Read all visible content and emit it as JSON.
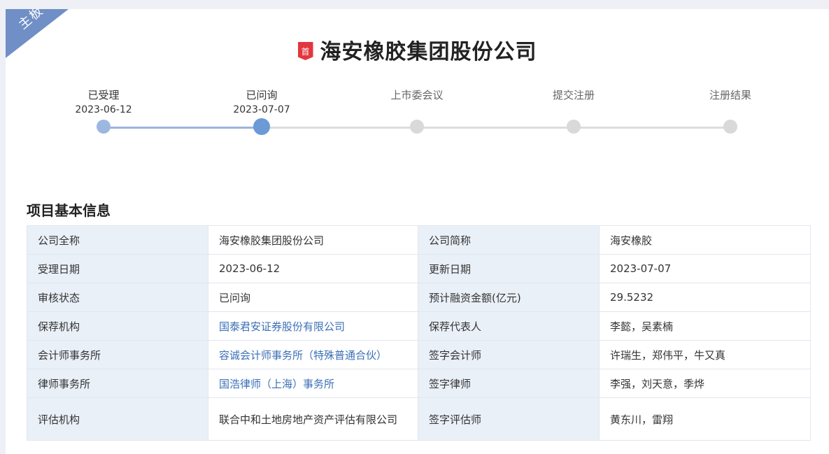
{
  "ribbon": {
    "label": "主板"
  },
  "header": {
    "badge": "首",
    "title": "海安橡胶集团股份公司"
  },
  "timeline": {
    "steps": [
      {
        "label": "已受理",
        "date": "2023-06-12",
        "state": "done"
      },
      {
        "label": "已问询",
        "date": "2023-07-07",
        "state": "current"
      },
      {
        "label": "上市委会议",
        "date": "",
        "state": "pending"
      },
      {
        "label": "提交注册",
        "date": "",
        "state": "pending"
      },
      {
        "label": "注册结果",
        "date": "",
        "state": "pending"
      }
    ]
  },
  "section": {
    "title": "项目基本信息"
  },
  "info": {
    "rows": [
      {
        "k1": "公司全称",
        "v1": "海安橡胶集团股份公司",
        "k2": "公司简称",
        "v2": "海安橡胶"
      },
      {
        "k1": "受理日期",
        "v1": "2023-06-12",
        "k2": "更新日期",
        "v2": "2023-07-07"
      },
      {
        "k1": "审核状态",
        "v1": "已问询",
        "k2": "预计融资金额(亿元)",
        "v2": "29.5232"
      },
      {
        "k1": "保荐机构",
        "v1": "国泰君安证券股份有限公司",
        "k2": "保荐代表人",
        "v2": "李懿，吴素楠"
      },
      {
        "k1": "会计师事务所",
        "v1": "容诚会计师事务所（特殊普通合伙）",
        "k2": "签字会计师",
        "v2": "许瑞生，郑伟平，牛又真"
      },
      {
        "k1": "律师事务所",
        "v1": "国浩律师（上海）事务所",
        "k2": "签字律师",
        "v2": "李强，刘天意，季烨"
      },
      {
        "k1": "评估机构",
        "v1": "联合中和土地房地产资产评估有限公司",
        "k2": "签字评估师",
        "v2": "黄东川，雷翔"
      }
    ]
  },
  "colors": {
    "accent": "#6b9ad6",
    "link": "#3b6fb6",
    "ribbon": "#6f8fc6",
    "badge": "#e2373f"
  }
}
